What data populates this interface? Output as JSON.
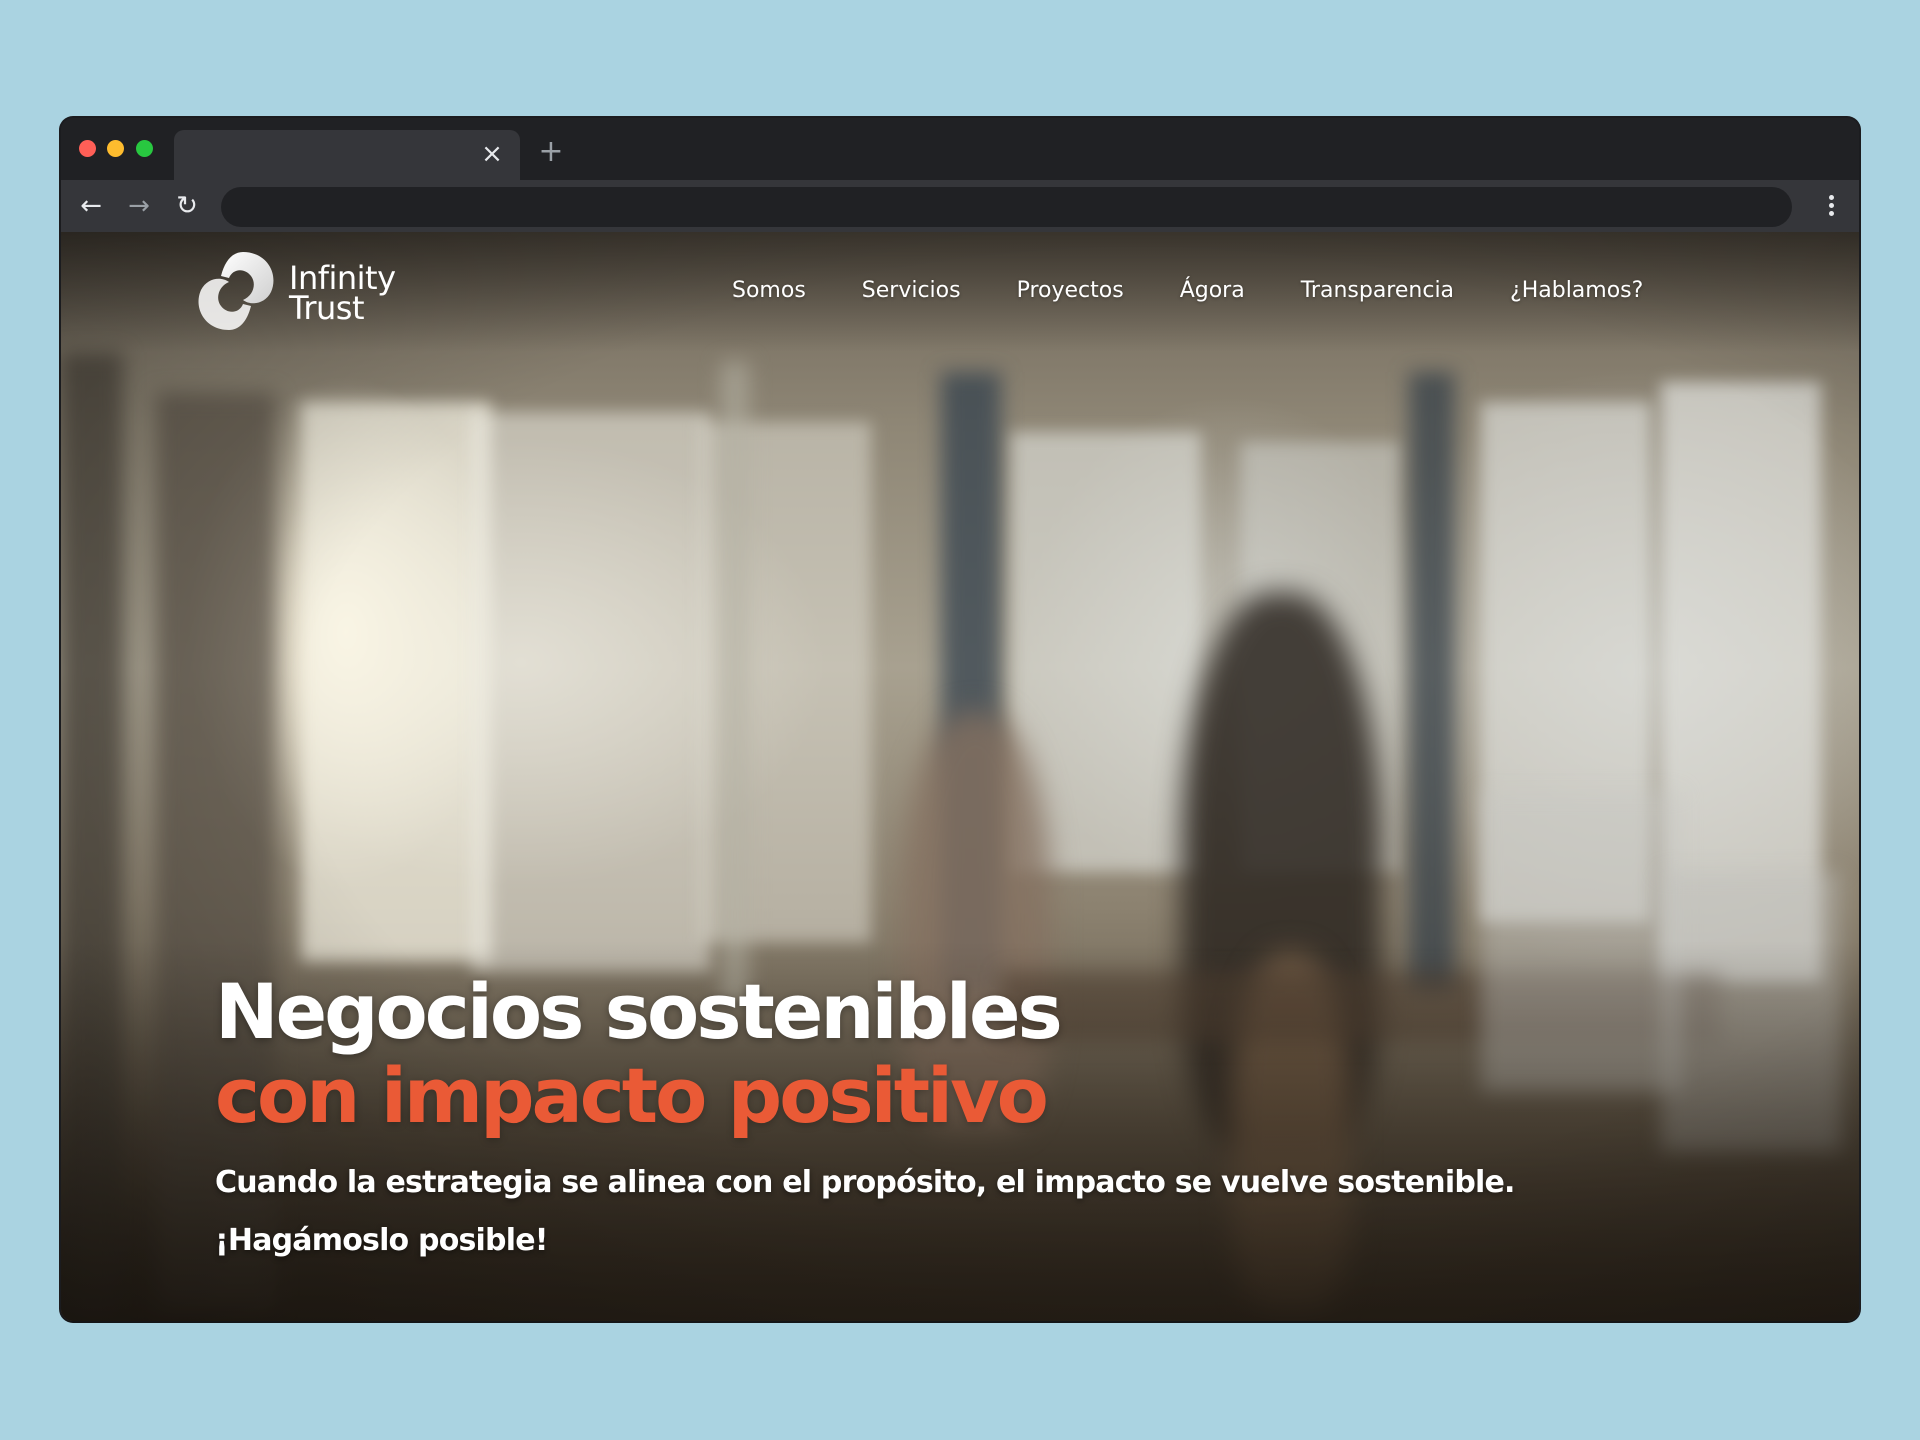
{
  "browser": {
    "tab_title": "",
    "tab_close_glyph": "×",
    "new_tab_glyph": "+",
    "back_glyph": "←",
    "forward_glyph": "→",
    "reload_glyph": "↻",
    "address": ""
  },
  "site": {
    "logo": {
      "line1": "Infinity",
      "line2": "Trust"
    },
    "nav": [
      {
        "label": "Somos"
      },
      {
        "label": "Servicios"
      },
      {
        "label": "Proyectos"
      },
      {
        "label": "Ágora"
      },
      {
        "label": "Transparencia"
      },
      {
        "label": "¿Hablamos?"
      }
    ],
    "hero": {
      "headline_line1": "Negocios sostenibles",
      "headline_line2": "con impacto positivo",
      "sub_line1": "Cuando la estrategia se alinea con el propósito, el impacto se vuelve sostenible.",
      "sub_line2": "¡Hagámoslo posible!"
    }
  },
  "colors": {
    "page_background": "#aad3e1",
    "browser_chrome": "#202124",
    "toolbar": "#35363a",
    "accent_orange": "#ea5a36",
    "text_white": "#ffffff"
  },
  "icons": {
    "traffic_lights": [
      "close-dot",
      "minimize-dot",
      "maximize-dot"
    ],
    "toolbar_menu": "more-vertical-icon",
    "logo_mark": "infinity-swirl-logo"
  }
}
